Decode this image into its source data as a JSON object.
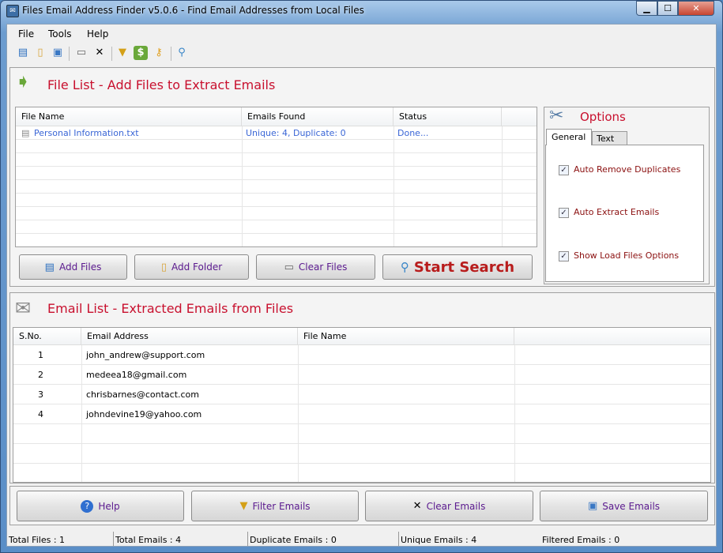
{
  "window": {
    "title": "Files Email Address Finder v5.0.6 -  Find Email Addresses from Local Files",
    "controls": [
      "minimize",
      "maximize",
      "close"
    ]
  },
  "menu": [
    "File",
    "Tools",
    "Help"
  ],
  "toolbar": [
    "add-files-icon",
    "add-folder-icon",
    "save-icon",
    "clear-list-icon",
    "close-icon",
    "filter-icon",
    "buy-icon",
    "key-icon",
    "search-icon"
  ],
  "file_panel": {
    "title": "File List - Add Files to Extract Emails",
    "columns": [
      "File Name",
      "Emails Found",
      "Status"
    ],
    "rows": [
      {
        "file": "Personal Information.txt",
        "found": "Unique: 4, Duplicate: 0",
        "status": "Done..."
      }
    ],
    "buttons": {
      "add_files": "Add Files",
      "add_folder": "Add Folder",
      "clear_files": "Clear Files",
      "start": "Start Search"
    }
  },
  "options": {
    "title": "Options",
    "tabs": [
      "General",
      "Text"
    ],
    "active_tab": "General",
    "items": [
      {
        "label": "Auto Remove Duplicates",
        "checked": true
      },
      {
        "label": "Auto Extract Emails",
        "checked": true
      },
      {
        "label": "Show Load Files Options",
        "checked": true
      }
    ]
  },
  "email_panel": {
    "title": "Email List - Extracted Emails from Files",
    "columns": [
      "S.No.",
      "Email Address",
      "File Name"
    ],
    "rows": [
      {
        "n": "1",
        "email": "john_andrew@support.com"
      },
      {
        "n": "2",
        "email": "medeea18@gmail.com"
      },
      {
        "n": "3",
        "email": "chrisbarnes@contact.com"
      },
      {
        "n": "4",
        "email": "johndevine19@yahoo.com"
      }
    ]
  },
  "bottom_buttons": {
    "help": "Help",
    "filter": "Filter Emails",
    "clear": "Clear Emails",
    "save": "Save Emails"
  },
  "status": {
    "total_files": "Total Files :  1",
    "total_emails": "Total Emails :  4",
    "duplicate": "Duplicate Emails :  0",
    "unique": "Unique Emails :  4",
    "filtered": "Filtered Emails :  0"
  },
  "colors": {
    "header_red": "#c8102e",
    "link_blue": "#3a66d6",
    "button_text": "#5b1a8f",
    "option_text": "#8b1010"
  }
}
